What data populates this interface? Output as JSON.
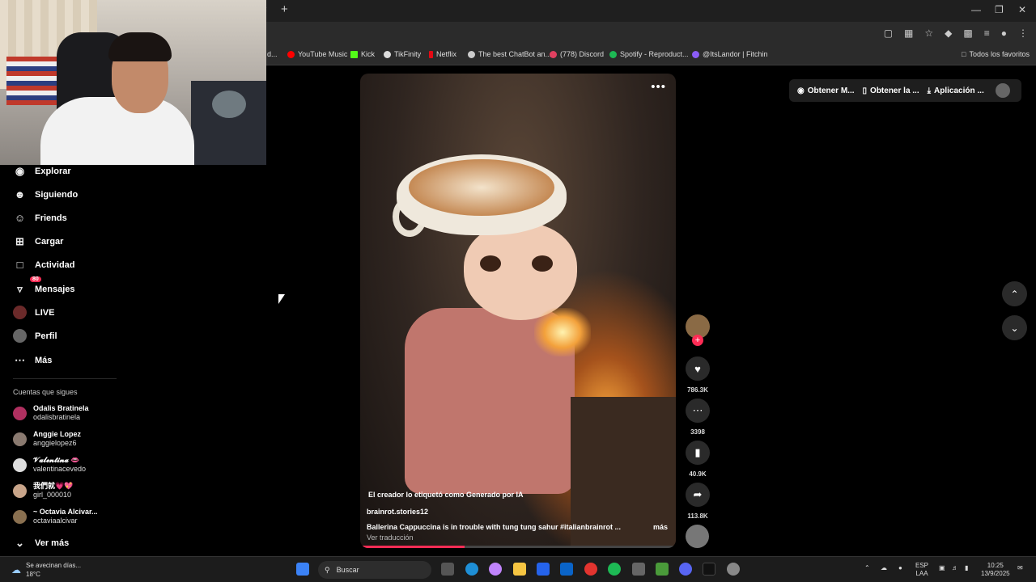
{
  "browser": {
    "bookmarks": [
      {
        "label": "d...",
        "color": "#888888"
      },
      {
        "label": "YouTube Music",
        "color": "#ff0000"
      },
      {
        "label": "Kick",
        "color": "#53fc18"
      },
      {
        "label": "TikFinity",
        "color": "#ffffff"
      },
      {
        "label": "Netflix",
        "color": "#e50914"
      },
      {
        "label": "The best ChatBot an...",
        "color": "#ffffff"
      },
      {
        "label": "(778) Discord",
        "color": "#e04060"
      },
      {
        "label": "Spotify - Reproduct...",
        "color": "#1db954"
      },
      {
        "label": "@ItsLandor | Fitchin",
        "color": "#8b5cf6"
      }
    ],
    "all_bookmarks_label": "Todos los favoritos"
  },
  "sidebar": {
    "items": [
      {
        "label": "Explorar",
        "icon": "compass-icon"
      },
      {
        "label": "Siguiendo",
        "icon": "following-icon"
      },
      {
        "label": "Friends",
        "icon": "friends-icon"
      },
      {
        "label": "Cargar",
        "icon": "upload-icon"
      },
      {
        "label": "Actividad",
        "icon": "activity-icon"
      },
      {
        "label": "Mensajes",
        "icon": "messages-icon",
        "badge": "80"
      },
      {
        "label": "LIVE",
        "icon": "live-icon"
      },
      {
        "label": "Perfil",
        "icon": "profile-icon"
      },
      {
        "label": "Más",
        "icon": "more-icon"
      }
    ],
    "following_title": "Cuentas que sigues",
    "accounts": [
      {
        "name": "Odalis Bratinela",
        "username": "odalisbratinela"
      },
      {
        "name": "Anggie Lopez",
        "username": "anggielopez6"
      },
      {
        "name": "𝓥𝓪𝓵𝓮𝓷𝓽𝓲𝓷𝓪 👄",
        "username": "valentinacevedo"
      },
      {
        "name": "我們就💗💖",
        "username": "girl_000010"
      },
      {
        "name": "~ Octavia Alcivar...",
        "username": "octaviaalcivar"
      }
    ],
    "see_more": "Ver más"
  },
  "video": {
    "ai_label": "El creador lo etiquetó como Generado por IA",
    "author": "brainrot.stories12",
    "description": "Ballerina Cappuccina is in trouble with tung tung sahur #italianbrainrot ...",
    "more": "más",
    "translate": "Ver traducción",
    "progress": 0.33
  },
  "actions": {
    "likes": "786.3K",
    "comments": "3398",
    "saves": "40.9K",
    "shares": "113.8K"
  },
  "top_actions": [
    {
      "label": "Obtener M...",
      "icon": "coin-icon"
    },
    {
      "label": "Obtener la ...",
      "icon": "phone-icon"
    },
    {
      "label": "Aplicación ...",
      "icon": "download-icon"
    }
  ],
  "taskbar": {
    "weather_text": "Se avecinan días...",
    "temperature": "18°C",
    "search_label": "Buscar",
    "lang_line1": "ESP",
    "lang_line2": "LAA",
    "time": "10:25",
    "date": "13/9/2025"
  }
}
